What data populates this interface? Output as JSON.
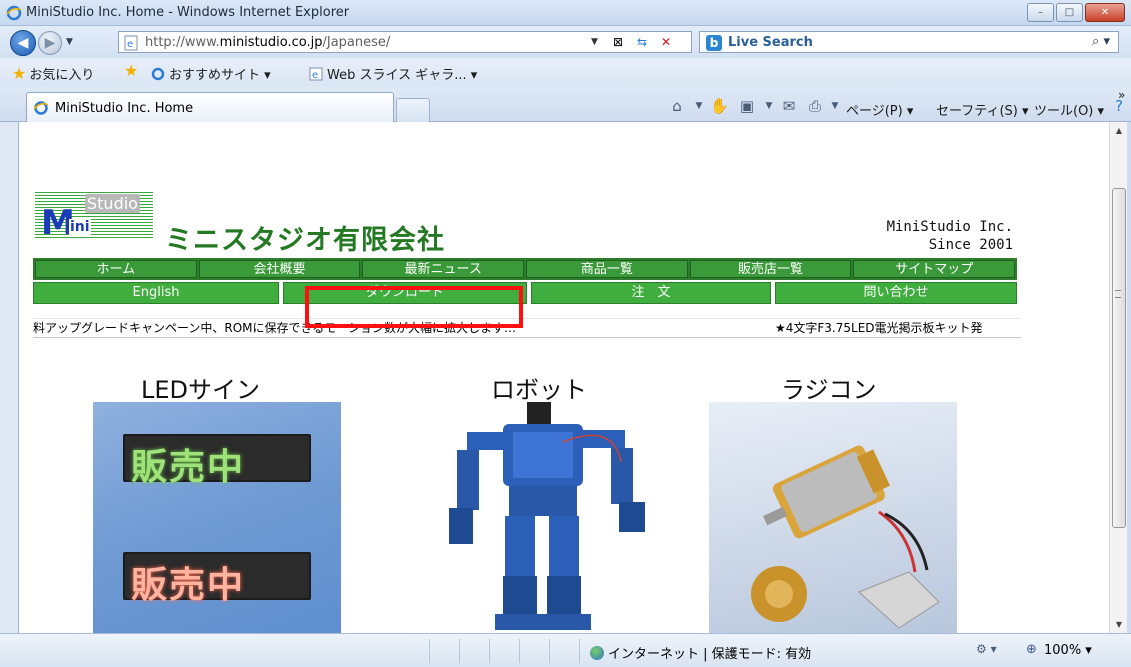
{
  "window": {
    "title": "MiniStudio Inc. Home - Windows Internet Explorer",
    "minimize": "–",
    "maximize": "□",
    "close": "✕"
  },
  "address": {
    "url_prefix": "http://www.",
    "url_host": "ministudio.co.jp",
    "url_path": "/Japanese/",
    "search_provider": "Live Search",
    "search_placeholder": ""
  },
  "favorites": {
    "favorites_label": "お気に入り",
    "suggested_sites": "おすすめサイト ▾",
    "web_slice": "Web スライス ギャラ... ▾"
  },
  "tabs": [
    {
      "label": "MiniStudio Inc. Home"
    }
  ],
  "commandbar": {
    "page": "ページ(P) ▾",
    "safety": "セーフティ(S) ▾",
    "tools": "ツール(O) ▾",
    "overflow": "»"
  },
  "page": {
    "logo_studio": "Studio",
    "logo_m": "M",
    "logo_ini": "ini",
    "company_jp": "ミニスタジオ有限会社",
    "company_en": "MiniStudio Inc.\n   Since 2001",
    "nav_row1": [
      "ホーム",
      "会社概要",
      "最新ニュース",
      "商品一覧",
      "販売店一覧",
      "サイトマップ"
    ],
    "nav_row2": [
      "English",
      "ダウンロード",
      "注　文",
      "問い合わせ"
    ],
    "ticker_left": "料アップグレードキャンペーン中、ROMに保存できるモーション数が大幅に拡大します…",
    "ticker_right": "★4文字F3.75LED電光掲示板キット発",
    "categories": [
      {
        "title": "LEDサイン",
        "led_green": "販売中",
        "led_red": "販売中"
      },
      {
        "title": "ロボット"
      },
      {
        "title": "ラジコン"
      }
    ]
  },
  "status": {
    "zone": "インターネット | 保護モード: 有効",
    "zoom": "100%  ▾"
  },
  "colors": {
    "nav_green": "#3a9a3a",
    "company_green": "#237a23",
    "highlight_red": "#ff1010"
  }
}
